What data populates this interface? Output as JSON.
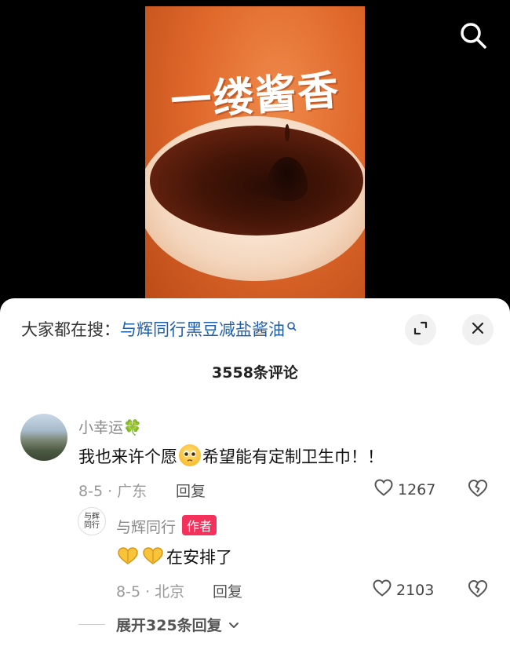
{
  "video": {
    "title_text": "一缕酱香"
  },
  "icons": {
    "search": "search-icon",
    "expand": "expand-icon",
    "close": "close-icon",
    "like": "heart-outline-icon",
    "dislike": "broken-heart-icon"
  },
  "search_suggestion": {
    "prefix": "大家都在搜：",
    "query": "与辉同行黑豆减盐酱油"
  },
  "comments_count": "3558条评论",
  "comments": [
    {
      "username": "小幸运🍀",
      "text_before_emoji": "我也来许个愿",
      "text_after_emoji": "希望能有定制卫生巾！！",
      "date_location": "8-5 · 广东",
      "reply_label": "回复",
      "likes": "1267",
      "replies": [
        {
          "username": "与辉同行",
          "badge": "作者",
          "avatar_text": "与辉同行",
          "text": "在安排了",
          "date_location": "8-5 · 北京",
          "reply_label": "回复",
          "likes": "2103"
        }
      ],
      "expand_label": "展开325条回复"
    }
  ],
  "colors": {
    "badge": "#f3315a",
    "link": "#1f5fa8"
  }
}
